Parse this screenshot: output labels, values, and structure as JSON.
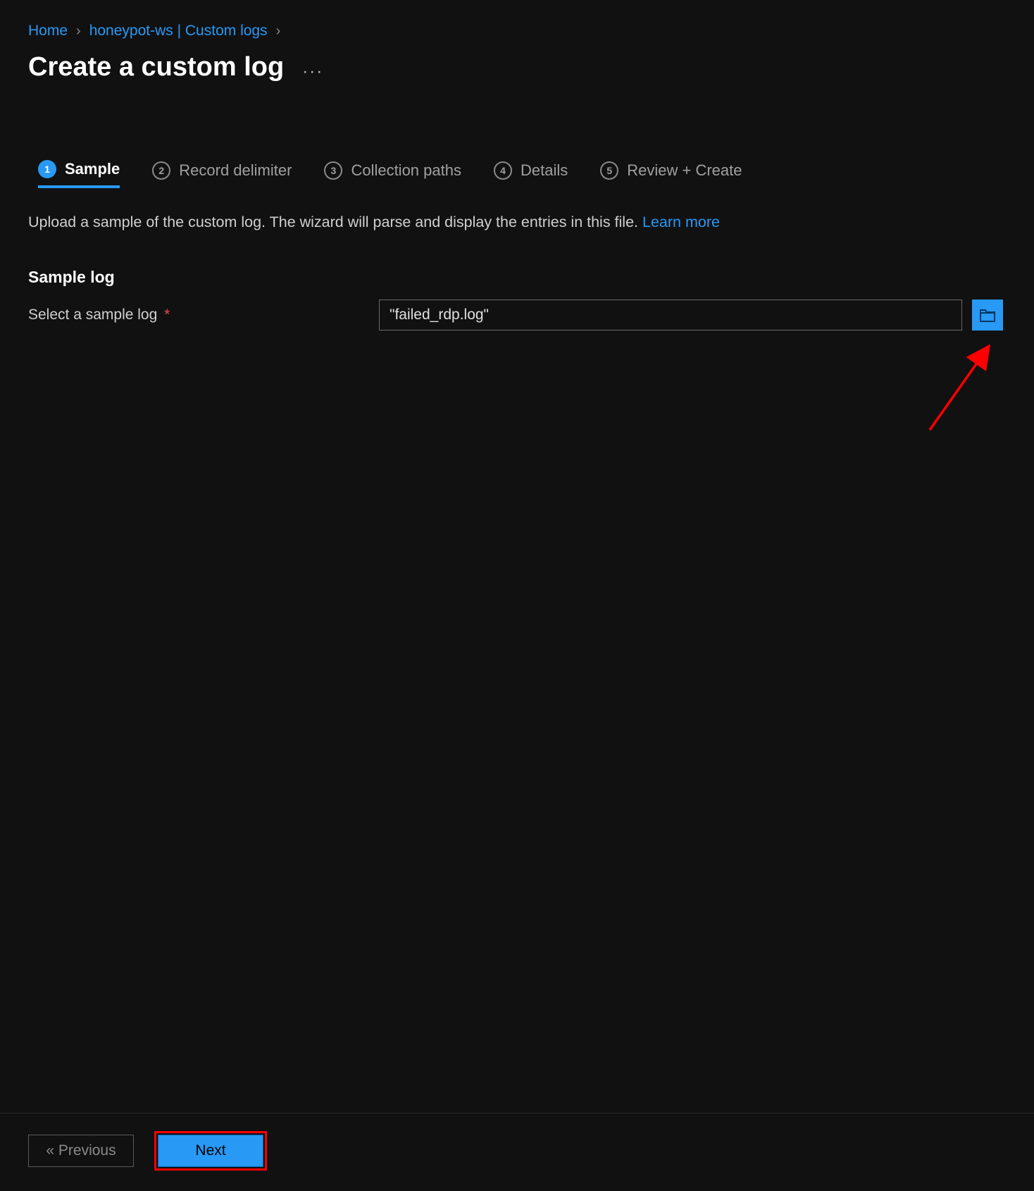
{
  "breadcrumb": {
    "items": [
      {
        "label": "Home"
      },
      {
        "label": "honeypot-ws | Custom logs"
      }
    ]
  },
  "page": {
    "title": "Create a custom log",
    "more": "···"
  },
  "wizard": {
    "steps": [
      {
        "num": "1",
        "label": "Sample",
        "active": true
      },
      {
        "num": "2",
        "label": "Record delimiter",
        "active": false
      },
      {
        "num": "3",
        "label": "Collection paths",
        "active": false
      },
      {
        "num": "4",
        "label": "Details",
        "active": false
      },
      {
        "num": "5",
        "label": "Review + Create",
        "active": false
      }
    ]
  },
  "desc": {
    "text": "Upload a sample of the custom log. The wizard will parse and display the entries in this file.",
    "learn": "Learn more"
  },
  "section": {
    "heading": "Sample log",
    "field_label": "Select a sample log",
    "required_mark": "*",
    "field_value": "\"failed_rdp.log\""
  },
  "footer": {
    "prev": "« Previous",
    "next": "Next"
  },
  "colors": {
    "accent": "#2899f5",
    "annotation": "#ff0000"
  }
}
